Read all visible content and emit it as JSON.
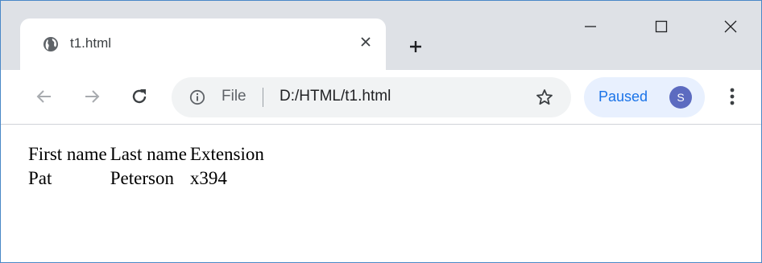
{
  "browser": {
    "tab": {
      "title": "t1.html",
      "icon": "globe-icon"
    },
    "address_bar": {
      "scheme_label": "File",
      "url": "D:/HTML/t1.html"
    },
    "profile": {
      "status": "Paused",
      "avatar_initial": "S",
      "avatar_color": "#5c6bc0"
    },
    "accent_color": "#1a73e8"
  },
  "page": {
    "table": {
      "headers": [
        "First name",
        "Last name",
        "Extension"
      ],
      "rows": [
        [
          "Pat",
          "Peterson",
          "x394"
        ]
      ]
    }
  }
}
